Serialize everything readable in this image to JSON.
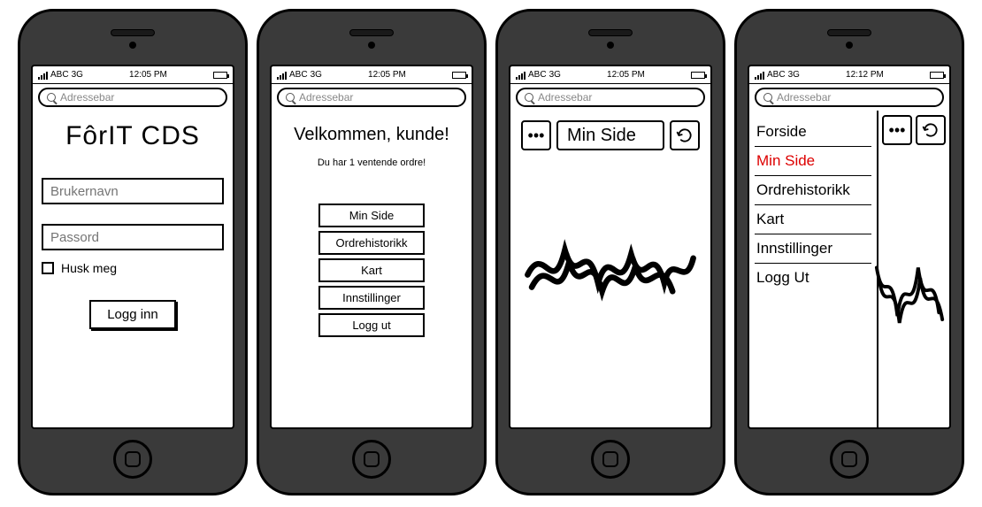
{
  "statusbar": {
    "carrier": "ABC",
    "network": "3G",
    "battery": "full"
  },
  "statusbar_times": {
    "s1": "12:05 PM",
    "s2": "12:05 PM",
    "s3": "12:05 PM",
    "s4": "12:12 PM"
  },
  "addressbar_placeholder": "Adressebar",
  "screen1": {
    "app_title": "FôrIT CDS",
    "username_placeholder": "Brukernavn",
    "password_placeholder": "Passord",
    "remember_label": "Husk meg",
    "login_label": "Logg inn"
  },
  "screen2": {
    "welcome": "Velkommen, kunde!",
    "pending": "Du har 1 ventende ordre!",
    "menu": {
      "min_side": "Min Side",
      "ordrehistorikk": "Ordrehistorikk",
      "kart": "Kart",
      "innstillinger": "Innstillinger",
      "logg_ut": "Logg ut"
    }
  },
  "screen3": {
    "title": "Min Side"
  },
  "screen4": {
    "drawer": {
      "forside": "Forside",
      "min_side": "Min Side",
      "ordrehistorikk": "Ordrehistorikk",
      "kart": "Kart",
      "innstillinger": "Innstillinger",
      "logg_ut": "Logg Ut"
    },
    "active_item": "min_side"
  }
}
